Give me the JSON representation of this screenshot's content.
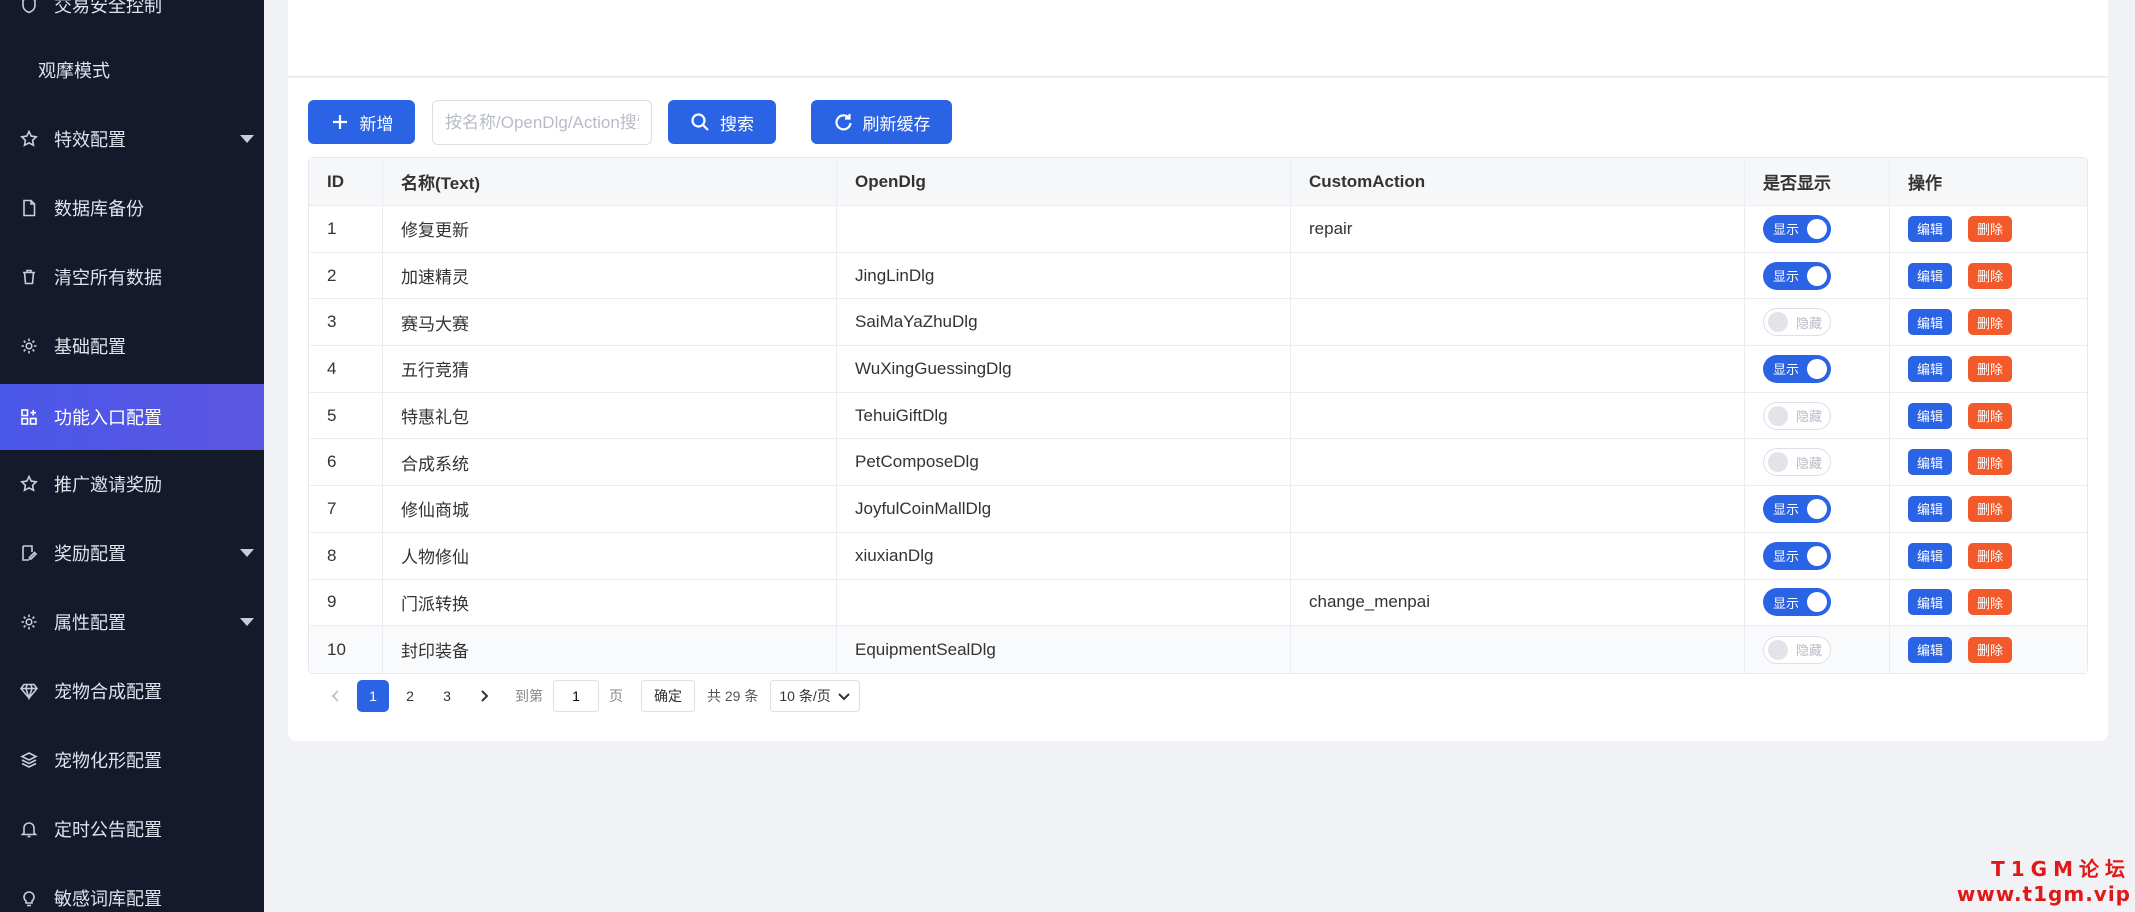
{
  "sidebar": {
    "items": [
      {
        "label": "交易安全控制",
        "icon": "shield-icon"
      },
      {
        "label": "观摩模式",
        "icon": ""
      },
      {
        "label": "特效配置",
        "icon": "star-icon"
      },
      {
        "label": "数据库备份",
        "icon": "file-icon"
      },
      {
        "label": "清空所有数据",
        "icon": "trash-icon"
      },
      {
        "label": "基础配置",
        "icon": "gear-icon"
      },
      {
        "label": "功能入口配置",
        "icon": "apps-icon"
      },
      {
        "label": "推广邀请奖励",
        "icon": "star-icon"
      },
      {
        "label": "奖励配置",
        "icon": "edit-doc-icon"
      },
      {
        "label": "属性配置",
        "icon": "gear-icon"
      },
      {
        "label": "宠物合成配置",
        "icon": "diamond-icon"
      },
      {
        "label": "宠物化形配置",
        "icon": "layers-icon"
      },
      {
        "label": "定时公告配置",
        "icon": "bell-icon"
      },
      {
        "label": "敏感词库配置",
        "icon": "bulb-icon"
      }
    ]
  },
  "toolbar": {
    "add_label": "新增",
    "search_placeholder": "按名称/OpenDlg/Action搜索",
    "search_label": "搜索",
    "refresh_label": "刷新缓存"
  },
  "table": {
    "headers": {
      "id": "ID",
      "name": "名称(Text)",
      "open": "OpenDlg",
      "action": "CustomAction",
      "show": "是否显示",
      "op": "操作"
    },
    "edit_label": "编辑",
    "delete_label": "删除",
    "show_on": "显示",
    "show_off": "隐藏",
    "rows": [
      {
        "id": "1",
        "name": "修复更新",
        "open": "",
        "action": "repair",
        "shown": true
      },
      {
        "id": "2",
        "name": "加速精灵",
        "open": "JingLinDlg",
        "action": "",
        "shown": true
      },
      {
        "id": "3",
        "name": "赛马大赛",
        "open": "SaiMaYaZhuDlg",
        "action": "",
        "shown": false
      },
      {
        "id": "4",
        "name": "五行竞猜",
        "open": "WuXingGuessingDlg",
        "action": "",
        "shown": true
      },
      {
        "id": "5",
        "name": "特惠礼包",
        "open": "TehuiGiftDlg",
        "action": "",
        "shown": false
      },
      {
        "id": "6",
        "name": "合成系统",
        "open": "PetComposeDlg",
        "action": "",
        "shown": false
      },
      {
        "id": "7",
        "name": "修仙商城",
        "open": "JoyfulCoinMallDlg",
        "action": "",
        "shown": true
      },
      {
        "id": "8",
        "name": "人物修仙",
        "open": "xiuxianDlg",
        "action": "",
        "shown": true
      },
      {
        "id": "9",
        "name": "门派转换",
        "open": "",
        "action": "change_menpai",
        "shown": true
      },
      {
        "id": "10",
        "name": "封印装备",
        "open": "EquipmentSealDlg",
        "action": "",
        "shown": false
      }
    ]
  },
  "pagination": {
    "pages": [
      "1",
      "2",
      "3"
    ],
    "current": "1",
    "goto_label": "到第",
    "goto_value": "1",
    "page_unit": "页",
    "confirm_label": "确定",
    "total_label": "共 29 条",
    "page_size": "10 条/页"
  },
  "watermark": {
    "line1": "T1GM论坛",
    "line2": "www.t1gm.vip"
  }
}
